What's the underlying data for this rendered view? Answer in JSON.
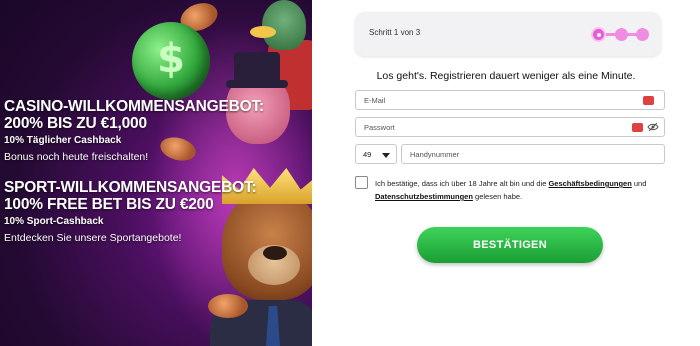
{
  "promo": {
    "casino": {
      "headline_line1": "CASINO-WILLKOMMENSANGEBOT:",
      "headline_line2": "200% BIS ZU €1,000",
      "sub": "10% Täglicher Cashback",
      "desc": "Bonus noch heute freischalten!"
    },
    "sport": {
      "headline_line1": "SPORT-WILLKOMMENSANGEBOT:",
      "headline_line2": "100% FREE BET BIS ZU €200",
      "sub": "10% Sport-Cashback",
      "desc": "Entdecken Sie unsere Sportangebote!"
    }
  },
  "steps": {
    "label": "Schritt 1 von 3",
    "current": 1,
    "total": 3
  },
  "form": {
    "intro": "Los geht's. Registrieren dauert weniger als eine Minute.",
    "email_placeholder": "E-Mail",
    "password_placeholder": "Passwort",
    "country_code": "49",
    "phone_placeholder": "Handynummer",
    "agree_text_1": "Ich bestätige, dass ich über 18 Jahre alt bin und die ",
    "agree_link_terms": "Geschäftsbedingungen",
    "agree_text_2": " und ",
    "agree_link_privacy": "Datenschutzbestimmungen",
    "agree_text_3": " gelesen habe.",
    "submit_label": "BESTÄTIGEN"
  },
  "colors": {
    "accent_pink": "#e85ad9",
    "submit_green": "#1a9e34",
    "warning_red": "#e04040"
  }
}
